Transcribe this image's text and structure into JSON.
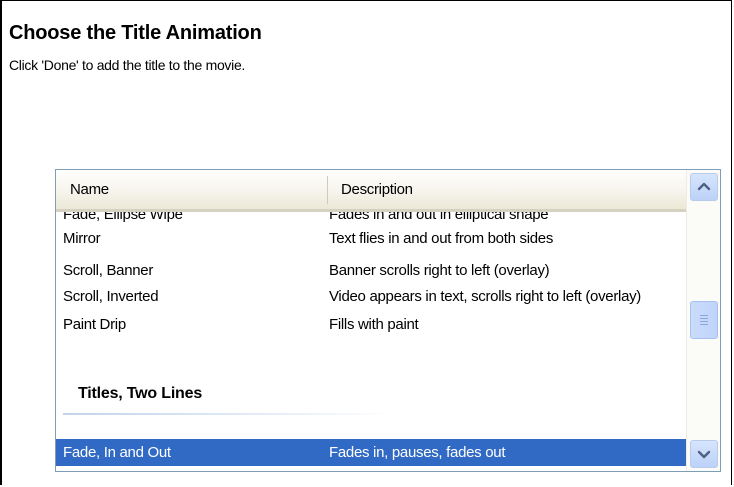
{
  "page": {
    "title": "Choose the Title Animation",
    "subtitle": "Click 'Done' to add the title to the movie."
  },
  "list": {
    "columns": {
      "name": "Name",
      "description": "Description"
    },
    "rows": [
      {
        "name": "Fade, Ellipse Wipe",
        "description": "Fades in and out in elliptical shape"
      },
      {
        "name": "Mirror",
        "description": "Text flies in and out from both sides"
      },
      {
        "name": "Scroll, Banner",
        "description": "Banner scrolls right to left (overlay)"
      },
      {
        "name": "Scroll, Inverted",
        "description": "Video appears in text, scrolls right to left (overlay)"
      },
      {
        "name": "Paint Drip",
        "description": "Fills with paint"
      }
    ],
    "group_label": "Titles, Two Lines",
    "selected_row": {
      "name": "Fade, In and Out",
      "description": "Fades in, pauses, fades out"
    }
  },
  "icons": {
    "scroll_up": "chevron-up-icon",
    "scroll_down": "chevron-down-icon",
    "thumb": "scroll-thumb-grip"
  },
  "colors": {
    "selection": "#316ac5",
    "header_bg": "#ece9d8",
    "scroll_button": "#c1d3fb"
  }
}
